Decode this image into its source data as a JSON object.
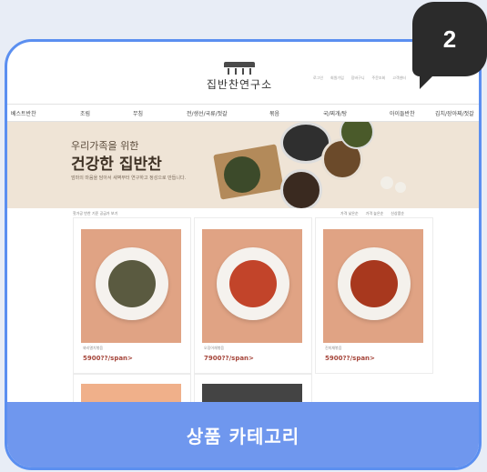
{
  "badge": "2",
  "logo": {
    "text": "집반찬연구소"
  },
  "util_links": [
    "로그인",
    "회원가입",
    "장바구니",
    "주문조회",
    "고객센터"
  ],
  "nav": [
    "베스트반찬",
    "조림",
    "무침",
    "전/생선/국류/젓갈",
    "볶음",
    "국/찌개/탕",
    "아이들반찬",
    "김치/장아찌/젓갈"
  ],
  "banner": {
    "subtitle": "우리가족을 위한",
    "title": "건강한 집반찬",
    "description": "엄마의 마음을 담아서 새벽부터 연구하고 정성으로 만듭니다."
  },
  "list": {
    "count_text": "핫가공 반찬 기준 공급가 보기",
    "sort_options": [
      "가격 낮은순",
      "가격 높은순",
      "신상품순"
    ]
  },
  "products": [
    {
      "name": "꽈리멸치볶음",
      "price": "5900??/span>"
    },
    {
      "name": "오징어채볶음",
      "price": "7900??/span>"
    },
    {
      "name": "진미채볶음",
      "price": "5900??/span>"
    }
  ],
  "footer_label": "상품 카테고리",
  "colors": {
    "accent": "#6f97ee",
    "border": "#5b8ff0",
    "price": "#a5453a"
  }
}
